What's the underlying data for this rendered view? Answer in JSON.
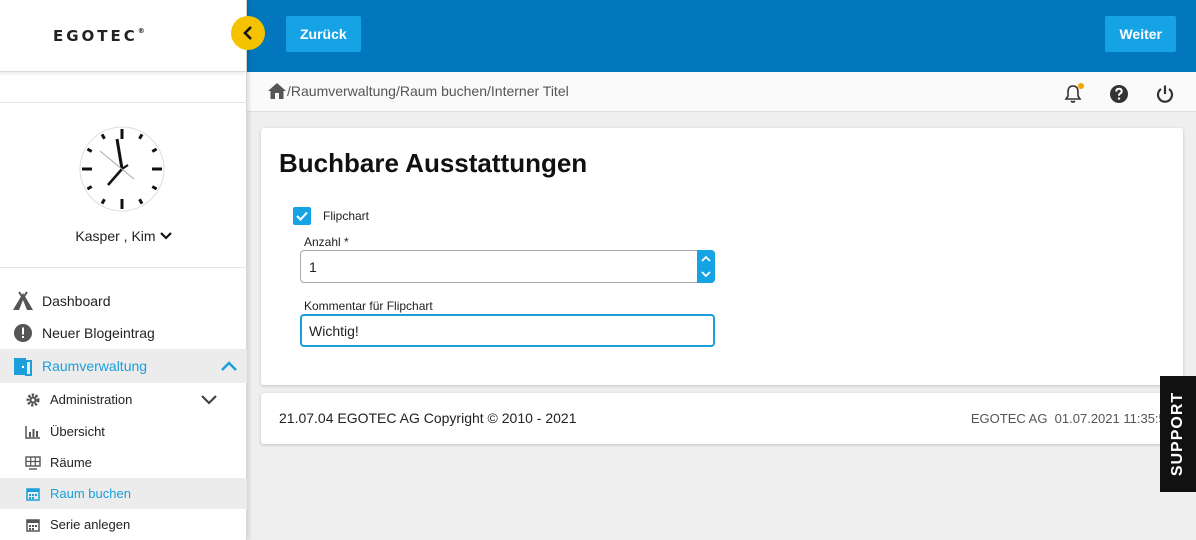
{
  "app": {
    "logo_text": "EGOTEC",
    "logo_mark": "®"
  },
  "topbar": {
    "back_label": "Zurück",
    "next_label": "Weiter"
  },
  "breadcrumb": {
    "items": [
      "Raumverwaltung",
      "Raum buchen",
      "Interner Titel"
    ],
    "separator": "/"
  },
  "user": {
    "name": "Kasper , Kim"
  },
  "sidebar": {
    "items": [
      {
        "label": "Dashboard",
        "icon": "tent-icon"
      },
      {
        "label": "Neuer Blogeintrag",
        "icon": "alert-circle-icon"
      },
      {
        "label": "Raumverwaltung",
        "icon": "door-icon",
        "active": true
      }
    ],
    "subitems": [
      {
        "label": "Administration",
        "icon": "gear-icon"
      },
      {
        "label": "Übersicht",
        "icon": "bar-chart-icon"
      },
      {
        "label": "Räume",
        "icon": "grid-icon"
      },
      {
        "label": "Raum buchen",
        "icon": "calendar-icon",
        "active": true
      },
      {
        "label": "Serie anlegen",
        "icon": "calendar-icon"
      }
    ]
  },
  "main": {
    "title": "Buchbare Ausstattungen",
    "checkbox": {
      "label": "Flipchart",
      "checked": true
    },
    "quantity": {
      "label": "Anzahl *",
      "value": "1"
    },
    "comment": {
      "label": "Kommentar für Flipchart",
      "value": "Wichtig!"
    }
  },
  "footer": {
    "left": "21.07.04 EGOTEC AG Copyright © 2010 - 2021",
    "right": "EGOTEC AG  01.07.2021 11:35:55"
  },
  "support": {
    "label": "SUPPORT"
  },
  "colors": {
    "topbar": "#0277bd",
    "button": "#16a3e6",
    "accent": "#1a9fdb",
    "collapse": "#f5c200"
  }
}
